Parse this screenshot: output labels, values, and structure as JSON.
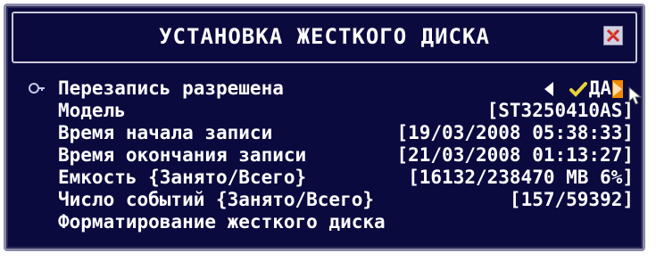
{
  "header": {
    "title": "УСТАНОВКА ЖЕСТКОГО ДИСКА",
    "close_icon": "close-x-icon"
  },
  "settings": [
    {
      "label": "Перезапись разрешена",
      "value": "ДА"
    },
    {
      "label": "Модель",
      "value": "[ST3250410AS]"
    },
    {
      "label": "Время начала записи",
      "value": "[19/03/2008 05:38:33]"
    },
    {
      "label": "Время окончания записи",
      "value": "[21/03/2008 01:13:27]"
    },
    {
      "label": "Емкость {Занято/Всего}",
      "value": "[16132/238470 MB 6%]"
    },
    {
      "label": "Число событий {Занято/Всего}",
      "value": "[157/59392]"
    },
    {
      "label": "Форматирование жесткого диска",
      "value": ""
    }
  ],
  "colors": {
    "background": "#0b0a3f",
    "text": "#ffffff",
    "accent_orange": "#f08a00",
    "check_yellow": "#e8d33a"
  },
  "icons": {
    "cursor": "key-pointer-icon",
    "prev": "arrow-left-icon",
    "check": "checkmark-icon",
    "next": "arrow-right-icon",
    "mouse": "mouse-pointer-icon"
  }
}
